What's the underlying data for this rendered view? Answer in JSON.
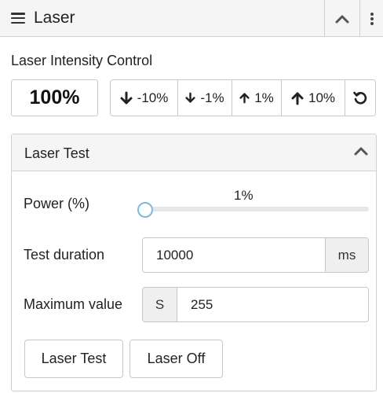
{
  "header": {
    "title": "Laser",
    "menu_icon": "hamburger-menu-icon",
    "collapse_icon": "chevron-up-icon",
    "more_icon": "vertical-dots-icon"
  },
  "intensity": {
    "label": "Laser Intensity Control",
    "value": "100%",
    "buttons": [
      {
        "label": "-10%",
        "icon": "arrow-down-icon"
      },
      {
        "label": "-1%",
        "icon": "arrow-down-icon"
      },
      {
        "label": "1%",
        "icon": "arrow-up-icon"
      },
      {
        "label": "10%",
        "icon": "arrow-up-icon"
      }
    ],
    "reset_icon": "reset-icon"
  },
  "laser_test": {
    "title": "Laser Test",
    "power_label": "Power (%)",
    "power_value": "1%",
    "power_fraction": 0.01,
    "duration_label": "Test duration",
    "duration_value": "10000",
    "duration_unit": "ms",
    "max_label": "Maximum value",
    "max_prefix": "S",
    "max_value": "255",
    "test_button": "Laser Test",
    "off_button": "Laser Off"
  },
  "colors": {
    "slider_thumb": "#7fb8e0",
    "header_bg": "#f5f5f5"
  }
}
